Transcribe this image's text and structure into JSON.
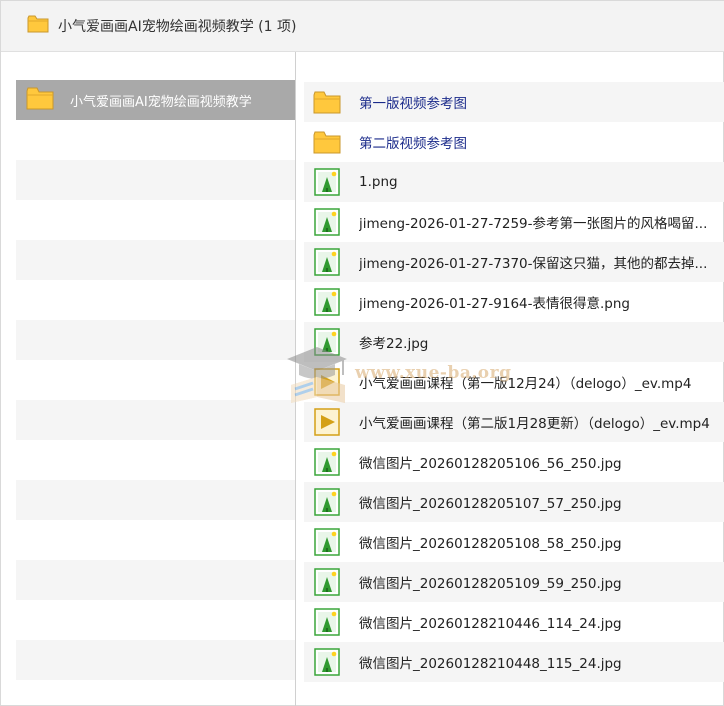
{
  "window": {
    "title": "小气爱画画AI宠物绘画视频教学 (1 项)",
    "title_icon": "folder-icon"
  },
  "left_pane": {
    "selected_folder": "小气爱画画AI宠物绘画视频教学",
    "selected_icon": "folder-icon"
  },
  "files": [
    {
      "name": "第一版视频参考图",
      "icon": "folder-icon",
      "kind": "folder"
    },
    {
      "name": "第二版视频参考图",
      "icon": "folder-icon",
      "kind": "folder"
    },
    {
      "name": "1.png",
      "icon": "image-file-icon",
      "kind": "image"
    },
    {
      "name": "jimeng-2026-01-27-7259-参考第一张图片的风格喝留...",
      "icon": "image-file-icon",
      "kind": "image"
    },
    {
      "name": "jimeng-2026-01-27-7370-保留这只猫，其他的都去掉...",
      "icon": "image-file-icon",
      "kind": "image"
    },
    {
      "name": "jimeng-2026-01-27-9164-表情很得意.png",
      "icon": "image-file-icon",
      "kind": "image"
    },
    {
      "name": "参考22.jpg",
      "icon": "image-file-icon",
      "kind": "image"
    },
    {
      "name": "小气爱画画课程（第一版12月24）（delogo）_ev.mp4",
      "icon": "video-file-icon",
      "kind": "video"
    },
    {
      "name": "小气爱画画课程（第二版1月28更新）（delogo）_ev.mp4",
      "icon": "video-file-icon",
      "kind": "video"
    },
    {
      "name": "微信图片_20260128205106_56_250.jpg",
      "icon": "image-file-icon",
      "kind": "image"
    },
    {
      "name": "微信图片_20260128205107_57_250.jpg",
      "icon": "image-file-icon",
      "kind": "image"
    },
    {
      "name": "微信图片_20260128205108_58_250.jpg",
      "icon": "image-file-icon",
      "kind": "image"
    },
    {
      "name": "微信图片_20260128205109_59_250.jpg",
      "icon": "image-file-icon",
      "kind": "image"
    },
    {
      "name": "微信图片_20260128210446_114_24.jpg",
      "icon": "image-file-icon",
      "kind": "image"
    },
    {
      "name": "微信图片_20260128210448_115_24.jpg",
      "icon": "image-file-icon",
      "kind": "image"
    }
  ],
  "watermark": {
    "text": "www.xue-ba.org",
    "icon": "graduation-cap-book-icon"
  },
  "colors": {
    "selection_bg": "#a9a9a9",
    "stripe_bg": "#f5f5f5",
    "folder_fill": "#ffc83d",
    "folder_link_text": "#1a2a8a",
    "image_icon_green": "#3aa53a",
    "video_icon_gold": "#d4a017"
  }
}
